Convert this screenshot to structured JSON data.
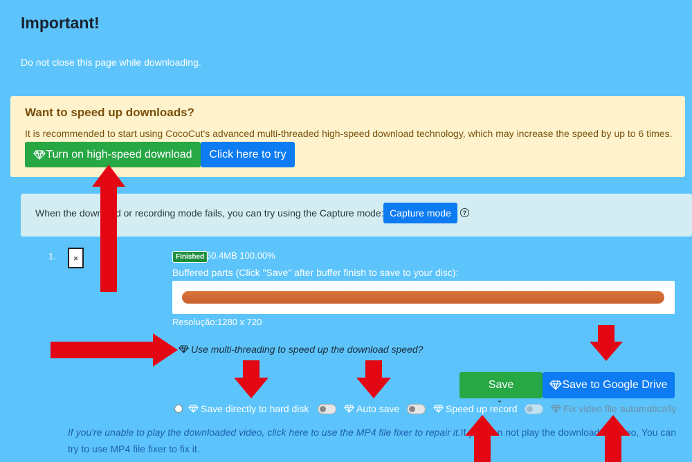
{
  "header": {
    "title": "Important!",
    "subtitle": "Do not close this page while downloading."
  },
  "promo": {
    "title": "Want to speed up downloads?",
    "text": "It is recommended to start using CocoCut's advanced multi-threaded high-speed download technology, which may increase the speed by up to 6 times.",
    "primary_button": "Turn on high-speed download",
    "secondary_button": "Click here to try"
  },
  "capture": {
    "text": "When the download or recording mode fails, you can try using the Capture mode:",
    "button": "Capture mode",
    "help": "?"
  },
  "item": {
    "index": "1.",
    "close": "×",
    "status_badge": "Finished",
    "size_progress": "50.4MB 100.00%",
    "buffered_label": "Buffered parts (Click \"Save\" after buffer finish to save to your disc):",
    "buffer_progress": 1.0,
    "resolution": "Resolução:1280 x 720",
    "multithread_link": "Use multi-threading to speed up the download speed?",
    "save_button": "Save",
    "drive_button": "Save to Google Drive",
    "caret": "⌄"
  },
  "options": {
    "direct": "Save directly to hard disk",
    "auto_save": "Auto save",
    "speed_record": "Speed up record",
    "fix_video": "Fix video file automatically"
  },
  "note": {
    "fixer_link": "If you're unable to play the downloaded video, click here to use the MP4 file fixer to repair it.",
    "fixer_text": "If you can not play the downloaded video, You can try to use MP4 file fixer to fix it."
  },
  "colors": {
    "background": "#5cc4fb",
    "accent_green": "#28a745",
    "accent_blue": "#0d7bf2",
    "annotation_arrow": "#e30613"
  },
  "icons": {
    "gem": "diamond-icon",
    "help": "question-circle-icon",
    "close": "close-icon"
  }
}
